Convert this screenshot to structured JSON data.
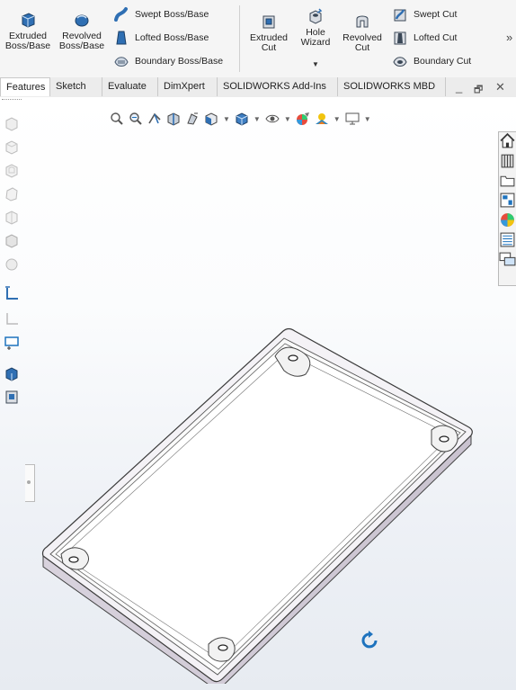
{
  "ribbon": {
    "extruded_boss": [
      "Extruded",
      "Boss/Base"
    ],
    "revolved_boss": [
      "Revolved",
      "Boss/Base"
    ],
    "swept_boss": "Swept Boss/Base",
    "lofted_boss": "Lofted Boss/Base",
    "boundary_boss": "Boundary Boss/Base",
    "extruded_cut": [
      "Extruded",
      "Cut"
    ],
    "hole_wizard": [
      "Hole",
      "Wizard"
    ],
    "revolved_cut": [
      "Revolved",
      "Cut"
    ],
    "swept_cut": "Swept Cut",
    "lofted_cut": "Lofted Cut",
    "boundary_cut": "Boundary Cut",
    "overflow": "»"
  },
  "tabs": [
    "Features",
    "Sketch",
    "Evaluate",
    "DimXpert",
    "SOLIDWORKS Add-Ins",
    "SOLIDWORKS MBD"
  ],
  "active_tab": "Features",
  "window_controls": {
    "minimize": "_",
    "restore": "🗗",
    "close": "✕"
  },
  "icons": {
    "heads_up": [
      "zoom-to-fit-icon",
      "zoom-area-icon",
      "previous-view-icon",
      "section-view-icon",
      "dynamic-annotation-icon",
      "view-orientation-icon",
      "display-style-icon",
      "hide-show-icon",
      "edit-appearance-icon",
      "apply-scene-icon",
      "view-settings-icon"
    ],
    "task_pane": [
      "home-icon",
      "design-library-icon",
      "file-explorer-icon",
      "view-palette-icon",
      "appearances-icon",
      "custom-properties-icon",
      "forum-icon"
    ]
  },
  "colors": {
    "accent": "#1e73be",
    "ribbon_bg": "#f5f5f5",
    "model_edge": "#444444"
  }
}
